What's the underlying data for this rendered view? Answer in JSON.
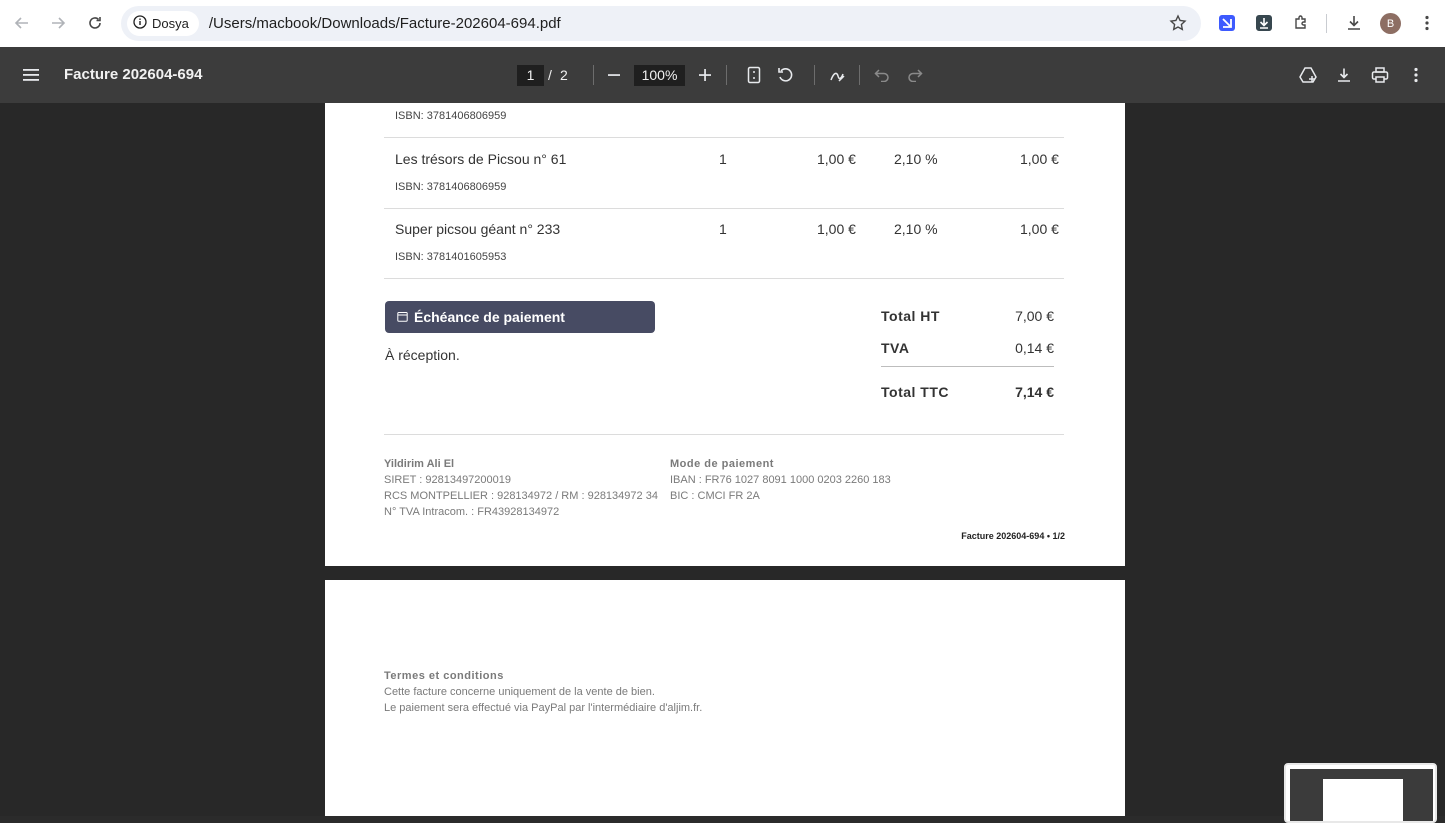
{
  "browser": {
    "site_chip": "Dosya",
    "url": "/Users/macbook/Downloads/Facture-202604-694.pdf",
    "avatar_letter": "B"
  },
  "pdf_toolbar": {
    "title": "Facture 202604-694",
    "current_page": "1",
    "page_sep": "/",
    "total_pages": "2",
    "zoom": "100%"
  },
  "invoice": {
    "top_isbn": "ISBN: 3781406806959",
    "items": [
      {
        "title": "Les trésors de Picsou n° 61",
        "isbn": "ISBN: 3781406806959",
        "qty": "1",
        "unit_price": "1,00 €",
        "vat": "2,10 %",
        "total": "1,00 €"
      },
      {
        "title": "Super picsou géant n° 233",
        "isbn": "ISBN: 3781401605953",
        "qty": "1",
        "unit_price": "1,00 €",
        "vat": "2,10 %",
        "total": "1,00 €"
      }
    ],
    "due_label": "Échéance de paiement",
    "due_value": "À réception.",
    "totals": {
      "ht_label": "Total HT",
      "ht_value": "7,00 €",
      "tva_label": "TVA",
      "tva_value": "0,14 €",
      "ttc_label": "Total TTC",
      "ttc_value": "7,14 €"
    },
    "footer_left": {
      "name": "Yildirim Ali El",
      "siret": "SIRET : 92813497200019",
      "rcs": "RCS MONTPELLIER : 928134972 / RM : 928134972 34",
      "tva": "N° TVA Intracom. : FR43928134972"
    },
    "footer_right": {
      "heading": "Mode de paiement",
      "iban": "IBAN : FR76 1027 8091 1000 0203 2260 183",
      "bic": "BIC : CMCI FR 2A"
    },
    "page_ref": "Facture 202604-694 • 1/2"
  },
  "page2": {
    "terms_heading": "Termes et conditions",
    "terms_line1": "Cette facture concerne uniquement de la vente de bien.",
    "terms_line2": "Le paiement sera effectué via PayPal par l'intermédiaire d'aljim.fr."
  },
  "icons": [
    "back-arrow-icon",
    "forward-arrow-icon",
    "reload-icon",
    "info-icon",
    "star-icon",
    "extension-icon",
    "download-icon",
    "menu-icon",
    "zoom-out-icon",
    "zoom-in-icon",
    "fit-page-icon",
    "rotate-icon",
    "annotate-icon",
    "undo-icon",
    "redo-icon",
    "drive-icon",
    "print-icon",
    "more-vert-icon",
    "calendar-icon"
  ]
}
